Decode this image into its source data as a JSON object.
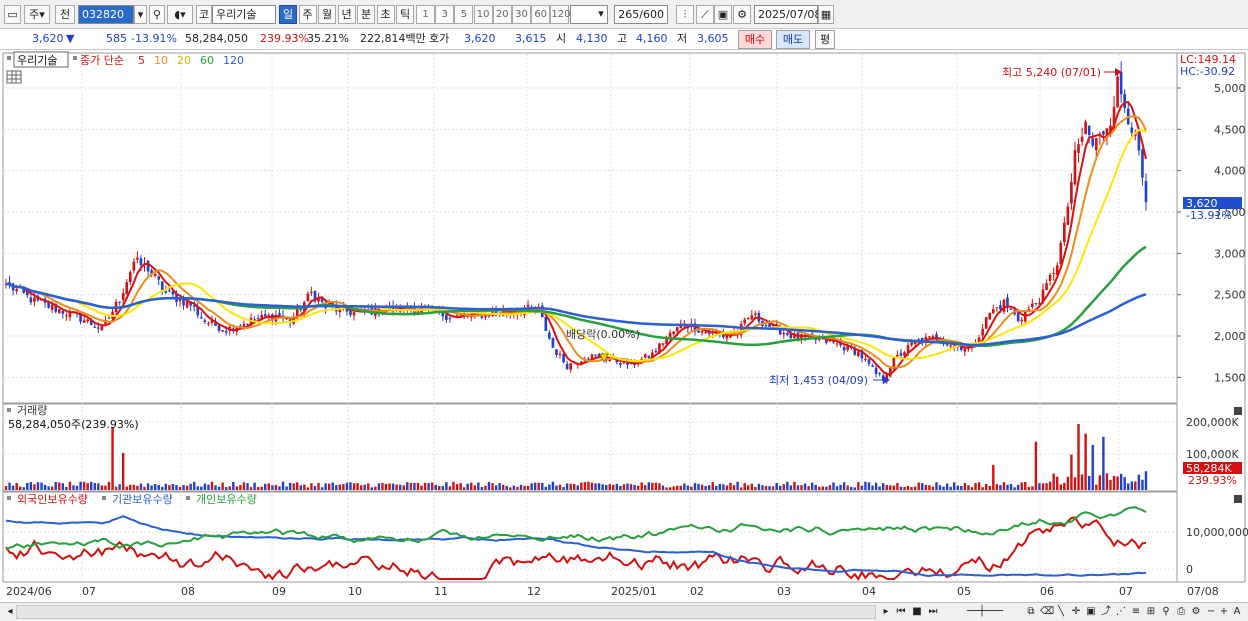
{
  "toolbar": {
    "market_type": "주",
    "prev_label": "전",
    "stock_code": "032820",
    "code_prefix": "코",
    "stock_name": "우리기술",
    "periods": [
      "일",
      "주",
      "월",
      "년",
      "분",
      "초",
      "틱"
    ],
    "active_period": "일",
    "minute_options": [
      "1",
      "3",
      "5",
      "10",
      "20",
      "30",
      "60",
      "120"
    ],
    "count_display": "265",
    "count_total": "/600",
    "date": "2025/07/08"
  },
  "quote": {
    "price": "3,620",
    "change_arrow": "▼",
    "change": "585",
    "change_pct": "-13.91%",
    "volume": "58,284,050",
    "volume_ratio": "239.93%",
    "turnover": "35.21%",
    "amount": "222,814백만",
    "bid_label": "호가",
    "bid": "3,620",
    "ask": "3,615",
    "open_label": "시",
    "open": "4,130",
    "high_label": "고",
    "high": "4,160",
    "low_label": "저",
    "low": "3,605",
    "buy_label": "매수",
    "sell_label": "매도",
    "avg_label": "평"
  },
  "price_panel": {
    "stock_tag": "우리기술",
    "ma_title": "종가 단순",
    "ma_periods": [
      "5",
      "10",
      "20",
      "60",
      "120"
    ],
    "ma_colors": [
      "#e01010",
      "#f08c1a",
      "#ffe600",
      "#28a03c",
      "#2a5fd8"
    ],
    "lc": "LC:149.14",
    "hc": "HC:-30.92",
    "y_ticks": [
      "5,000",
      "4,500",
      "4,000",
      "3,500",
      "3,000",
      "2,500",
      "2,000",
      "1,500"
    ],
    "y_values": [
      5000,
      4500,
      4000,
      3500,
      3000,
      2500,
      2000,
      1500
    ],
    "current_price_label": "3,620",
    "current_change_label": "-13.91%",
    "annot_high": "최고 5,240 (07/01)",
    "annot_low": "최저 1,453 (04/09)",
    "annot_dividend": "배당락(0.00%)"
  },
  "volume_panel": {
    "title": "거래량",
    "value_label": "58,284,050주(239.93%)",
    "y_ticks": [
      "200,000K",
      "100,000K"
    ],
    "current_label": "58,284K",
    "current_pct": "239.93%"
  },
  "holder_panel": {
    "legends": [
      {
        "label": "외국인보유수량",
        "color": "#e01010"
      },
      {
        "label": "기관보유수량",
        "color": "#2a5fd8"
      },
      {
        "label": "개인보유수량",
        "color": "#28a03c"
      }
    ],
    "y_ticks": [
      "10,000,000",
      "0"
    ]
  },
  "x_axis": {
    "labels": [
      "2024/06",
      "07",
      "08",
      "09",
      "10",
      "11",
      "12",
      "2025/01",
      "02",
      "03",
      "04",
      "05",
      "06",
      "07"
    ],
    "right_label": "07/08"
  },
  "chart_data": {
    "type": "candlestick",
    "x_range": [
      "2024/06",
      "2025/07/08"
    ],
    "ylim": [
      1350,
      5350
    ],
    "price_anchors": [
      {
        "i": 0,
        "v": 2630
      },
      {
        "i": 8,
        "v": 2420
      },
      {
        "i": 20,
        "v": 2240
      },
      {
        "i": 27,
        "v": 2080
      },
      {
        "i": 32,
        "v": 2450
      },
      {
        "i": 36,
        "v": 2900
      },
      {
        "i": 40,
        "v": 2820
      },
      {
        "i": 45,
        "v": 2520
      },
      {
        "i": 52,
        "v": 2380
      },
      {
        "i": 56,
        "v": 2180
      },
      {
        "i": 62,
        "v": 2080
      },
      {
        "i": 70,
        "v": 2200
      },
      {
        "i": 76,
        "v": 2250
      },
      {
        "i": 80,
        "v": 2180
      },
      {
        "i": 86,
        "v": 2520
      },
      {
        "i": 90,
        "v": 2350
      },
      {
        "i": 98,
        "v": 2280
      },
      {
        "i": 106,
        "v": 2320
      },
      {
        "i": 116,
        "v": 2330
      },
      {
        "i": 126,
        "v": 2230
      },
      {
        "i": 136,
        "v": 2270
      },
      {
        "i": 146,
        "v": 2330
      },
      {
        "i": 150,
        "v": 2310
      },
      {
        "i": 152,
        "v": 2080
      },
      {
        "i": 154,
        "v": 1860
      },
      {
        "i": 158,
        "v": 1640
      },
      {
        "i": 164,
        "v": 1760
      },
      {
        "i": 170,
        "v": 1720
      },
      {
        "i": 176,
        "v": 1650
      },
      {
        "i": 182,
        "v": 1780
      },
      {
        "i": 186,
        "v": 1980
      },
      {
        "i": 191,
        "v": 2160
      },
      {
        "i": 196,
        "v": 2060
      },
      {
        "i": 202,
        "v": 2000
      },
      {
        "i": 206,
        "v": 2050
      },
      {
        "i": 210,
        "v": 2260
      },
      {
        "i": 214,
        "v": 2140
      },
      {
        "i": 222,
        "v": 1990
      },
      {
        "i": 232,
        "v": 1930
      },
      {
        "i": 240,
        "v": 1800
      },
      {
        "i": 245,
        "v": 1540
      },
      {
        "i": 247,
        "v": 1480
      },
      {
        "i": 250,
        "v": 1710
      },
      {
        "i": 256,
        "v": 1930
      },
      {
        "i": 262,
        "v": 1980
      },
      {
        "i": 267,
        "v": 1880
      },
      {
        "i": 272,
        "v": 1860
      },
      {
        "i": 277,
        "v": 2280
      },
      {
        "i": 281,
        "v": 2400
      },
      {
        "i": 285,
        "v": 2200
      },
      {
        "i": 289,
        "v": 2360
      },
      {
        "i": 292,
        "v": 2500
      },
      {
        "i": 296,
        "v": 2900
      },
      {
        "i": 298,
        "v": 3300
      },
      {
        "i": 301,
        "v": 4150
      },
      {
        "i": 304,
        "v": 4550
      },
      {
        "i": 306,
        "v": 4300
      },
      {
        "i": 308,
        "v": 4400
      },
      {
        "i": 311,
        "v": 4650
      },
      {
        "i": 313,
        "v": 5050
      },
      {
        "i": 315,
        "v": 4800
      },
      {
        "i": 317,
        "v": 4550
      },
      {
        "i": 319,
        "v": 4180
      },
      {
        "i": 321,
        "v": 3620
      }
    ],
    "volume_spikes": [
      {
        "i": 30,
        "v": 195000
      },
      {
        "i": 33,
        "v": 115000
      },
      {
        "i": 278,
        "v": 78000
      },
      {
        "i": 290,
        "v": 150000
      },
      {
        "i": 300,
        "v": 110000
      },
      {
        "i": 302,
        "v": 205000
      },
      {
        "i": 304,
        "v": 175000
      },
      {
        "i": 306,
        "v": 140000
      },
      {
        "i": 309,
        "v": 165000
      },
      {
        "i": 321,
        "v": 58284
      }
    ],
    "xlabel": "",
    "ylabel": ""
  }
}
